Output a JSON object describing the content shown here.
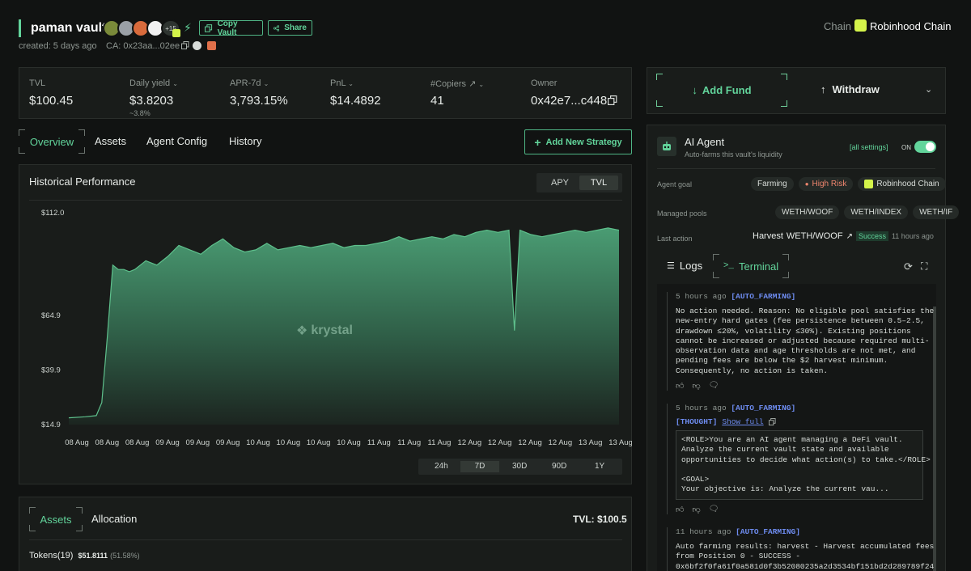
{
  "vault": {
    "name": "paman vault",
    "copiers_more": "+15",
    "copy_label": "Copy Vault",
    "share_label": "Share",
    "created": "created: 5 days ago",
    "ca": "CA: 0x23aa...02ee",
    "chain_label": "Chain",
    "chain_name": "Robinhood Chain"
  },
  "stats": {
    "tvl_label": "TVL",
    "tvl_value": "$100.45",
    "daily_label": "Daily yield",
    "daily_value": "$3.8203",
    "daily_sub": "~3.8%",
    "apr_label": "APR-7d",
    "apr_value": "3,793.15%",
    "pnl_label": "PnL",
    "pnl_value": "$14.4892",
    "copiers_label": "#Copiers",
    "copiers_value": "41",
    "owner_label": "Owner",
    "owner_value": "0x42e7...c448"
  },
  "fund": {
    "add_label": "Add Fund",
    "withdraw_label": "Withdraw"
  },
  "tabs": {
    "overview": "Overview",
    "assets": "Assets",
    "agent_config": "Agent Config",
    "history": "History",
    "add_strategy": "Add New Strategy"
  },
  "perf": {
    "title": "Historical Performance",
    "toggle_apy": "APY",
    "toggle_tvl": "TVL",
    "watermark": "krystal"
  },
  "ranges": [
    "24h",
    "7D",
    "30D",
    "90D",
    "1Y"
  ],
  "chart_data": {
    "type": "area",
    "y_ticks": [
      "$112.0",
      "$64.9",
      "$39.9",
      "$14.9"
    ],
    "x_ticks": [
      "08 Aug",
      "08 Aug",
      "08 Aug",
      "09 Aug",
      "09 Aug",
      "09 Aug",
      "10 Aug",
      "10 Aug",
      "10 Aug",
      "10 Aug",
      "11 Aug",
      "11 Aug",
      "11 Aug",
      "12 Aug",
      "12 Aug",
      "12 Aug",
      "12 Aug",
      "13 Aug",
      "13 Aug"
    ],
    "x": [
      0,
      3,
      5,
      6,
      7,
      8,
      9,
      10,
      11,
      12,
      13,
      14,
      16,
      18,
      20,
      22,
      24,
      26,
      28,
      30,
      32,
      34,
      36,
      38,
      40,
      42,
      44,
      46,
      48,
      50,
      52,
      54,
      56,
      58,
      60,
      62,
      64,
      66,
      68,
      70,
      72,
      74,
      76,
      78,
      80,
      81,
      82,
      83,
      84,
      86,
      88,
      90,
      92,
      94,
      96,
      98,
      100
    ],
    "values": [
      18,
      18.5,
      19,
      25,
      55,
      88,
      86,
      86,
      85,
      86,
      88,
      90,
      88,
      92,
      97,
      95,
      93,
      97,
      100,
      96,
      94,
      95,
      98,
      95,
      96,
      97,
      96,
      97,
      98,
      96,
      97,
      97,
      98,
      99,
      101,
      99,
      100,
      101,
      100,
      102,
      101,
      103,
      104,
      103,
      104,
      58,
      104,
      103,
      102,
      101,
      102,
      103,
      104,
      103,
      104,
      105,
      104
    ],
    "ylim": [
      14.9,
      112.0
    ]
  },
  "bottom": {
    "assets_tab": "Assets",
    "allocation_tab": "Allocation",
    "tvl_total": "TVL: $100.5",
    "tokens_label": "Tokens(19)",
    "tokens_value": "$51.8111",
    "tokens_pct": "(51.58%)"
  },
  "agent": {
    "title": "AI Agent",
    "subtitle": "Auto-farms this vault's liquidity",
    "settings_link": "[all settings]",
    "toggle_label": "ON",
    "goal_label": "Agent goal",
    "goal_chips": [
      "Farming",
      "High Risk",
      "Robinhood Chain"
    ],
    "pools_label": "Managed pools",
    "pools": [
      "WETH/WOOF",
      "WETH/INDEX",
      "WETH/IF"
    ],
    "last_action_label": "Last action",
    "last_action": "Harvest",
    "last_action_pool": "WETH/WOOF",
    "last_action_status": "Success",
    "last_action_time": "11 hours ago",
    "logs_tab": "Logs",
    "terminal_tab": "Terminal"
  },
  "terminal": [
    {
      "time": "5 hours ago",
      "tag": "[AUTO_FARMING]",
      "body": "No action needed. Reason: No eligible pool satisfies the\nnew-entry hard gates (fee persistence between 0.5–2.5,\ndrawdown ≤20%, volatility ≤30%). Existing positions\ncannot be increased or adjusted because required multi-\nobservation data and age thresholds are not met, and\npending fees are below the $2 harvest minimum.\nConsequently, no action is taken."
    },
    {
      "time": "5 hours ago",
      "tag": "[AUTO_FARMING]",
      "thought": "[THOUGHT]",
      "show_full": "Show full",
      "box": "<ROLE>You are an AI agent managing a DeFi vault.\nAnalyze the current vault state and available\nopportunities to decide what action(s) to take.</ROLE>\n\n<GOAL>\nYour objective is: Analyze the current vau..."
    },
    {
      "time": "11 hours ago",
      "tag": "[AUTO_FARMING]",
      "body": "Auto farming results: harvest - Harvest accumulated fees\nfrom Position 0 - SUCCESS -\n0x6bf2f0fa61f0a581d0f3b52080235a2d3534bf151bd2d289789f24"
    }
  ]
}
